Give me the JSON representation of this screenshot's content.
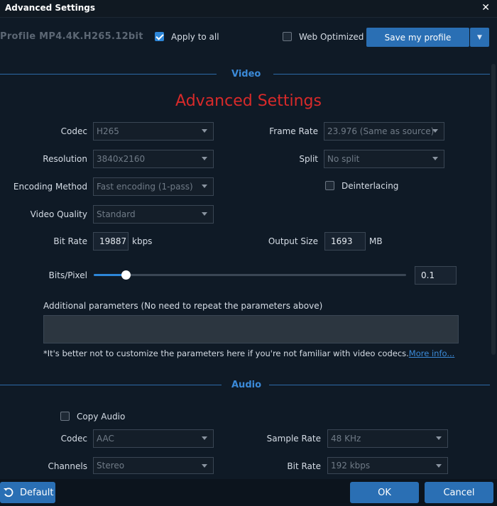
{
  "window": {
    "title": "Advanced Settings",
    "close_glyph": "✕"
  },
  "profile": {
    "text": "Profile  MP4.4K.H265.12bit"
  },
  "apply_all": {
    "label": "Apply to all",
    "checked": true
  },
  "web_optimized": {
    "label": "Web Optimized",
    "checked": false
  },
  "save_profile": {
    "label": "Save my profile",
    "dropdown_glyph": "▼"
  },
  "video": {
    "section": "Video",
    "heading": "Advanced Settings",
    "codec": {
      "label": "Codec",
      "value": "H265"
    },
    "resolution": {
      "label": "Resolution",
      "value": "3840x2160"
    },
    "encoding": {
      "label": "Encoding Method",
      "value": "Fast encoding (1-pass)"
    },
    "quality": {
      "label": "Video Quality",
      "value": "Standard"
    },
    "frame_rate": {
      "label": "Frame Rate",
      "value": "23.976 (Same as source)"
    },
    "split": {
      "label": "Split",
      "value": "No split"
    },
    "deinterlacing": {
      "label": "Deinterlacing",
      "checked": false
    },
    "bit_rate": {
      "label": "Bit Rate",
      "value": "19887",
      "unit": "kbps"
    },
    "output_size": {
      "label": "Output Size",
      "value": "1693",
      "unit": "MB"
    },
    "bits_pixel": {
      "label": "Bits/Pixel",
      "value": "0.1",
      "slider_fraction": 0.1
    },
    "additional": {
      "label": "Additional parameters (No need to repeat the parameters above)",
      "value": ""
    },
    "note": "*It's better not to customize the parameters here if you're not familiar with video codecs.",
    "more_info": "More info..."
  },
  "audio": {
    "section": "Audio",
    "copy_audio": {
      "label": "Copy Audio",
      "checked": false
    },
    "codec": {
      "label": "Codec",
      "value": "AAC"
    },
    "channels": {
      "label": "Channels",
      "value": "Stereo"
    },
    "sample_rate": {
      "label": "Sample Rate",
      "value": "48 KHz"
    },
    "bit_rate": {
      "label": "Bit Rate",
      "value": "192 kbps"
    }
  },
  "footer": {
    "default_label": "Default",
    "ok_label": "OK",
    "cancel_label": "Cancel"
  },
  "colors": {
    "accent": "#2a6fb4",
    "heading_red": "#d82a2a",
    "section_blue": "#3b8ad8",
    "background": "#0f1a26"
  }
}
